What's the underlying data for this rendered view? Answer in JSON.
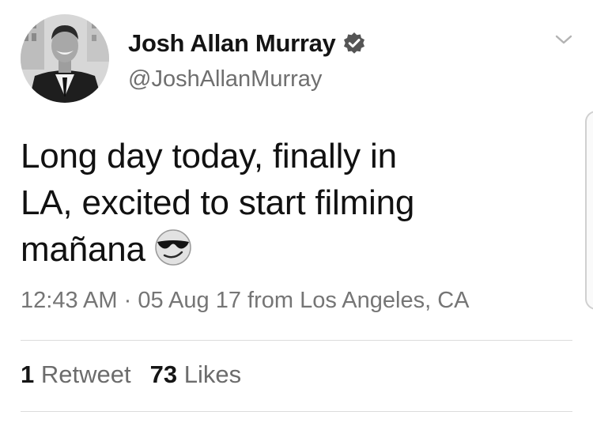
{
  "tweet": {
    "author": {
      "display_name": "Josh Allan Murray",
      "handle": "@JoshAllanMurray",
      "verified": true
    },
    "text_lines": [
      "Long day today, finally in",
      "LA, excited to start filming",
      "mañana"
    ],
    "emoji": "smiling-face-with-sunglasses",
    "time": "12:43 AM",
    "separator": "·",
    "date": "05 Aug 17",
    "location_prefix": "from",
    "location": "Los Angeles, CA",
    "stats": {
      "retweet_count": "1",
      "retweet_label": "Retweet",
      "like_count": "73",
      "like_label": "Likes"
    }
  },
  "icons": {
    "verified": "verified-badge-icon",
    "menu": "chevron-down-icon",
    "emoji": "sunglasses-emoji-icon"
  },
  "colors": {
    "background": "#ffffff",
    "text": "#111111",
    "secondary_text": "#6f6f6f",
    "divider": "#dcdcdc"
  }
}
